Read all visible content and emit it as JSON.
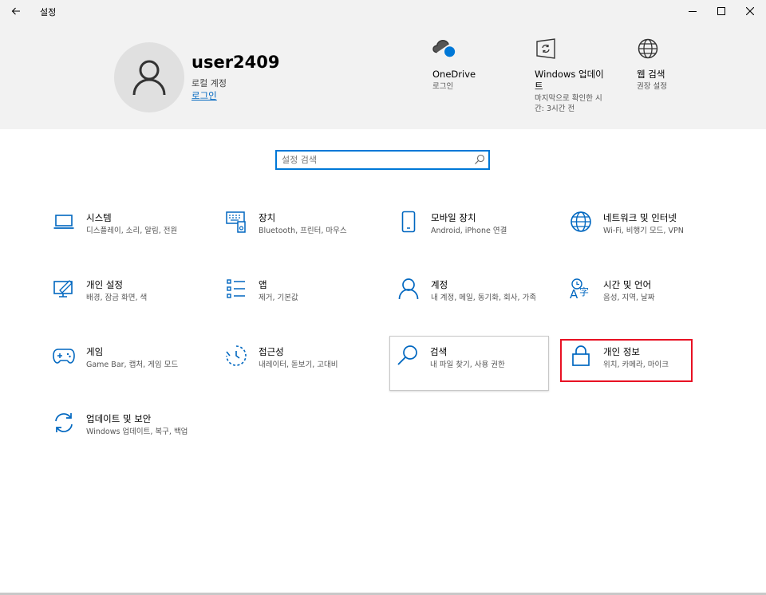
{
  "window": {
    "title": "설정",
    "back_icon": "back-arrow-icon",
    "controls": [
      "minimize-icon",
      "maximize-icon",
      "close-icon"
    ]
  },
  "account": {
    "username": "user2409",
    "type": "로컬 계정",
    "signin_label": "로그인"
  },
  "header_items": [
    {
      "icon": "onedrive-icon",
      "label": "OneDrive",
      "sub": "로그인"
    },
    {
      "icon": "windows-update-icon",
      "label": "Windows 업데이트",
      "sub": "마지막으로 확인한 시간: 3시간 전"
    },
    {
      "icon": "globe-icon",
      "label": "웹 검색",
      "sub": "권장 설정"
    }
  ],
  "search": {
    "placeholder": "설정 검색"
  },
  "categories": [
    {
      "id": "system",
      "icon": "laptop-icon",
      "name": "시스템",
      "desc": "디스플레이, 소리, 알림, 전원"
    },
    {
      "id": "devices",
      "icon": "devices-icon",
      "name": "장치",
      "desc": "Bluetooth, 프린터, 마우스"
    },
    {
      "id": "phone",
      "icon": "phone-icon",
      "name": "모바일 장치",
      "desc": "Android, iPhone 연결"
    },
    {
      "id": "network",
      "icon": "globe-icon",
      "name": "네트워크 및 인터넷",
      "desc": "Wi-Fi, 비행기 모드, VPN"
    },
    {
      "id": "personalization",
      "icon": "personalization-icon",
      "name": "개인 설정",
      "desc": "배경, 잠금 화면, 색"
    },
    {
      "id": "apps",
      "icon": "apps-icon",
      "name": "앱",
      "desc": "제거, 기본값"
    },
    {
      "id": "accounts",
      "icon": "person-icon",
      "name": "계정",
      "desc": "내 계정, 메일, 동기화, 회사, 가족"
    },
    {
      "id": "time-language",
      "icon": "time-language-icon",
      "name": "시간 및 언어",
      "desc": "음성, 지역, 날짜"
    },
    {
      "id": "gaming",
      "icon": "gamepad-icon",
      "name": "게임",
      "desc": "Game Bar, 캡처, 게임 모드"
    },
    {
      "id": "ease-of-access",
      "icon": "ease-of-access-icon",
      "name": "접근성",
      "desc": "내레이터, 돋보기, 고대비"
    },
    {
      "id": "search",
      "icon": "search-icon",
      "name": "검색",
      "desc": "내 파일 찾기, 사용 권한"
    },
    {
      "id": "privacy",
      "icon": "lock-icon",
      "name": "개인 정보",
      "desc": "위치, 카메라, 마이크"
    },
    {
      "id": "update-security",
      "icon": "sync-icon",
      "name": "업데이트 및 보안",
      "desc": "Windows 업데이트, 복구, 백업"
    }
  ],
  "colors": {
    "accent": "#0078d7",
    "header_bg": "#f2f2f2",
    "highlight": "#e81123"
  }
}
